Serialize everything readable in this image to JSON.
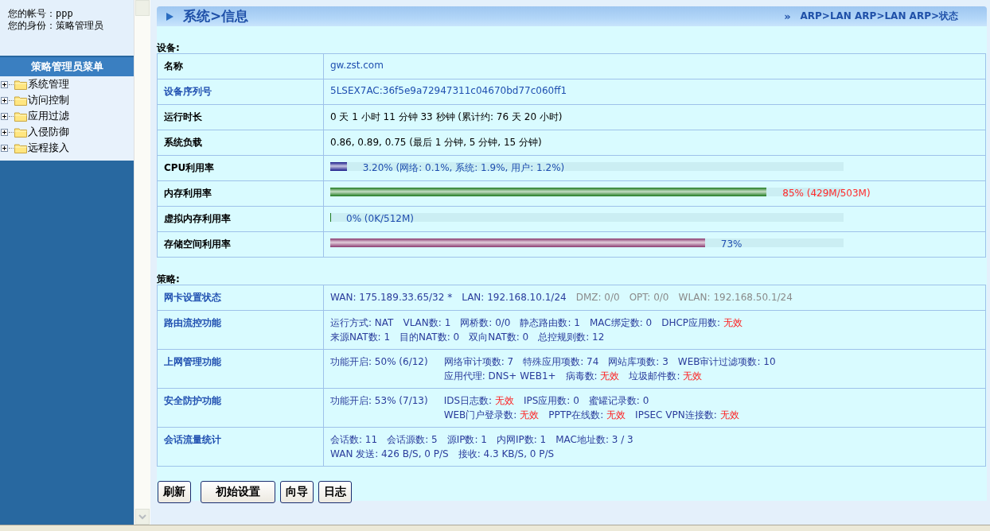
{
  "account": {
    "lines": [
      "您的帐号：ppp",
      "您的身份：策略管理员"
    ]
  },
  "menu": {
    "title": "策略管理员菜单",
    "items": [
      {
        "label": "系统管理",
        "expanded": false
      },
      {
        "label": "访问控制",
        "expanded": false
      },
      {
        "label": "应用过滤",
        "expanded": false
      },
      {
        "label": "入侵防御",
        "expanded": false
      },
      {
        "label": "远程接入",
        "expanded": false
      }
    ]
  },
  "header": {
    "title": "系统>信息",
    "breadcrumb_mark": "»",
    "breadcrumb": "ARP>LAN ARP>LAN ARP>状态"
  },
  "device": {
    "heading": "设备:",
    "rows": [
      {
        "label": "名称",
        "label_link": false,
        "kind": "text",
        "value": "gw.zst.com",
        "value_dark": false
      },
      {
        "label": "设备序列号",
        "label_link": true,
        "kind": "text",
        "value": "5LSEX7AC:36f5e9a72947311c04670bd77c060ff1",
        "value_dark": false
      },
      {
        "label": "运行时长",
        "label_link": false,
        "kind": "text",
        "value": "0 天 1 小时 11 分钟 33 秒钟 (累计约: 76 天 20 小时)",
        "value_dark": true
      },
      {
        "label": "系统负载",
        "label_link": false,
        "kind": "text",
        "value": "0.86, 0.89, 0.75 (最后  1 分钟, 5 分钟, 15 分钟)",
        "value_dark": true
      },
      {
        "label": "CPU利用率",
        "label_link": false,
        "kind": "bar",
        "color": "#1a1a8a",
        "level": 0.032,
        "value": "3.20% (网络: 0.1%, 系统: 1.9%, 用户: 1.2%)",
        "warning": false
      },
      {
        "label": "内存利用率",
        "label_link": false,
        "kind": "bar",
        "color": "#1e7a1e",
        "level": 0.85,
        "value": "85% (429M/503M)",
        "warning": true
      },
      {
        "label": "虚拟内存利用率",
        "label_link": false,
        "kind": "bar",
        "color": "#1e7a1e",
        "level": 0,
        "value": "0% (0K/512M)",
        "warning": false
      },
      {
        "label": "存储空间利用率",
        "label_link": false,
        "kind": "bar",
        "color": "#8a3a70",
        "level": 0.73,
        "value": "73%",
        "warning": false
      }
    ]
  },
  "policy": {
    "heading": "策略:",
    "rows": [
      {
        "label": "网卡设置状态",
        "lines": [
          [
            {
              "text": "WAN: 175.189.33.65/32 *",
              "muted": false
            },
            {
              "text": "LAN: 192.168.10.1/24",
              "muted": false
            },
            {
              "text": "DMZ: 0/0",
              "muted": true
            },
            {
              "text": "OPT: 0/0",
              "muted": true
            },
            {
              "text": "WLAN: 192.168.50.1/24",
              "muted": true
            }
          ]
        ]
      },
      {
        "label": "路由流控功能",
        "lines": [
          [
            {
              "text": "运行方式: NAT"
            },
            {
              "text": "VLAN数: 1"
            },
            {
              "text": "网桥数: 0/0"
            },
            {
              "text": "静态路由数: 1"
            },
            {
              "text": "MAC绑定数: 0"
            },
            {
              "text": "DHCP应用数: ",
              "alert": "无效"
            }
          ],
          [
            {
              "text": "来源NAT数: 1"
            },
            {
              "text": "目的NAT数: 0"
            },
            {
              "text": "双向NAT数: 0"
            },
            {
              "text": "总控规则数: 12"
            }
          ]
        ]
      },
      {
        "label": "上网管理功能",
        "lead": {
          "text": "功能开启: 50% (6/12)"
        },
        "lines": [
          [
            {
              "text": "网络审计项数: 7"
            },
            {
              "text": "特殊应用项数: 74"
            },
            {
              "text": "网站库项数: 3"
            },
            {
              "text": "WEB审计过滤项数: 10"
            }
          ],
          [
            {
              "text": "应用代理: DNS+ WEB1+"
            },
            {
              "text": "病毒数: ",
              "alert": "无效"
            },
            {
              "text": "垃圾邮件数: ",
              "alert": "无效"
            }
          ]
        ]
      },
      {
        "label": "安全防护功能",
        "lead": {
          "text": "功能开启: 53% (7/13)"
        },
        "lines": [
          [
            {
              "text": "IDS日志数: ",
              "alert": "无效"
            },
            {
              "text": "IPS应用数: 0"
            },
            {
              "text": "蜜罐记录数: 0"
            }
          ],
          [
            {
              "text": "WEB门户登录数: ",
              "alert": "无效"
            },
            {
              "text": "PPTP在线数: ",
              "alert": "无效"
            },
            {
              "text": "IPSEC VPN连接数: ",
              "alert": "无效"
            }
          ]
        ]
      },
      {
        "label": "会话流量统计",
        "lines": [
          [
            {
              "text": "会话数: 11"
            },
            {
              "text": "会话源数: 5"
            },
            {
              "text": "源IP数: 1"
            },
            {
              "text": "内网IP数: 1"
            },
            {
              "text": "MAC地址数: 3 / 3"
            }
          ],
          [
            {
              "text": "WAN 发送: 426 B/S, 0 P/S"
            },
            {
              "text": "接收: 4.3 KB/S, 0 P/S"
            }
          ]
        ]
      }
    ]
  },
  "buttons": [
    "刷新",
    "初始设置",
    "向导",
    "日志"
  ]
}
